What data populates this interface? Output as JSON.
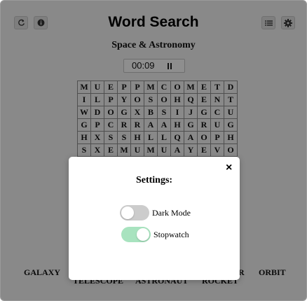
{
  "header": {
    "title": "Word Search",
    "subtitle": "Space & Astronomy",
    "left_icons": [
      "refresh-icon",
      "info-icon"
    ],
    "right_icons": [
      "list-icon",
      "gear-icon"
    ]
  },
  "timer": {
    "value": "00:09",
    "control_icon": "pause-icon"
  },
  "grid": {
    "rows": [
      [
        "M",
        "U",
        "E",
        "P",
        "P",
        "M",
        "C",
        "O",
        "M",
        "E",
        "T",
        "D"
      ],
      [
        "I",
        "L",
        "P",
        "Y",
        "O",
        "S",
        "O",
        "H",
        "Q",
        "E",
        "N",
        "T"
      ],
      [
        "W",
        "D",
        "O",
        "G",
        "X",
        "B",
        "S",
        "I",
        "J",
        "G",
        "C",
        "U"
      ],
      [
        "G",
        "P",
        "C",
        "R",
        "R",
        "A",
        "A",
        "H",
        "G",
        "R",
        "U",
        "G"
      ],
      [
        "H",
        "X",
        "S",
        "S",
        "H",
        "L",
        "L",
        "Q",
        "A",
        "O",
        "P",
        "H"
      ],
      [
        "S",
        "X",
        "E",
        "M",
        "U",
        "M",
        "U",
        "A",
        "Y",
        "E",
        "V",
        "O"
      ]
    ]
  },
  "words": {
    "row1": [
      "GALAXY",
      "R",
      "ORBIT"
    ],
    "row2": [
      "TELESCOPE",
      "ASTRONAUT",
      "ROCKET"
    ]
  },
  "settings_modal": {
    "title": "Settings:",
    "close_symbol": "×",
    "toggles": [
      {
        "label": "Dark Mode",
        "on": false
      },
      {
        "label": "Stopwatch",
        "on": true
      }
    ]
  },
  "colors": {
    "toggle_on": "#a8e3bf",
    "toggle_off": "#cccccc",
    "overlay": "rgba(0,0,0,0.42)"
  }
}
